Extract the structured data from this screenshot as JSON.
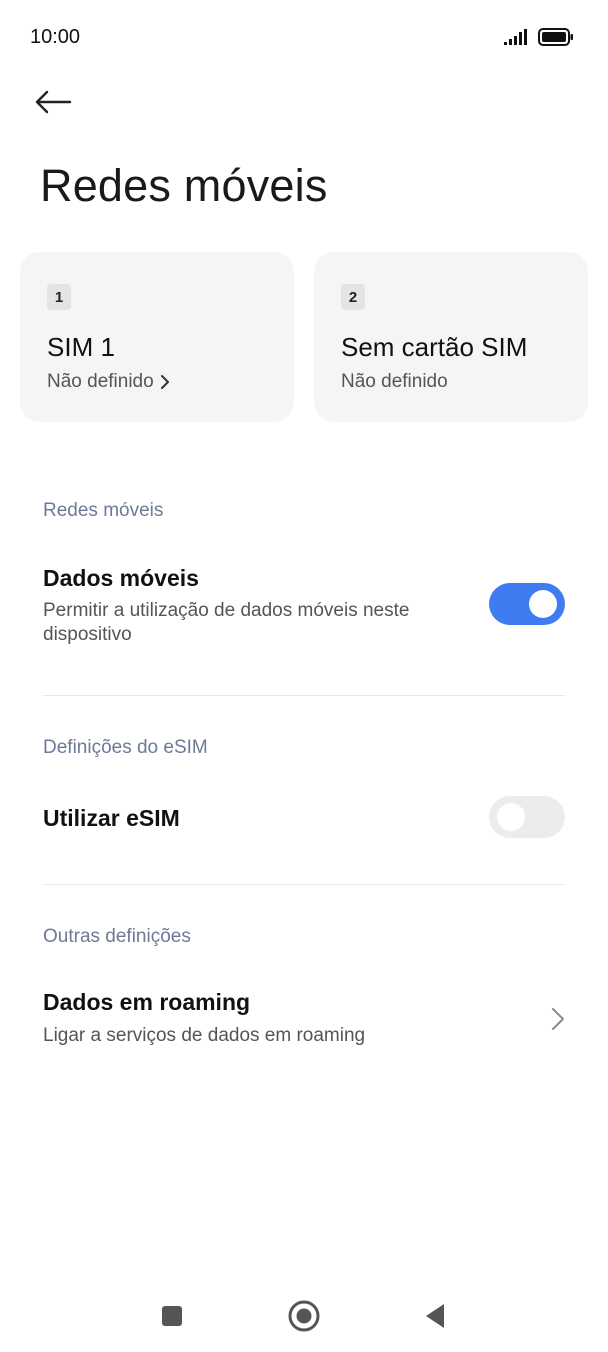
{
  "status_bar": {
    "time": "10:00",
    "icons": [
      "signal-icon",
      "battery-icon"
    ]
  },
  "header": {
    "back_icon": "arrow-left-icon",
    "title": "Redes móveis"
  },
  "sim_cards": [
    {
      "slot": "1",
      "name": "SIM 1",
      "status": "Não definido",
      "has_chevron": true
    },
    {
      "slot": "2",
      "name": "Sem cartão SIM",
      "status": "Não definido",
      "has_chevron": false
    }
  ],
  "sections": {
    "mobile_networks": {
      "header": "Redes móveis",
      "mobile_data": {
        "title": "Dados móveis",
        "subtitle": "Permitir a utilização de dados móveis neste dispositivo",
        "enabled": true
      }
    },
    "esim": {
      "header": "Definições do eSIM",
      "use_esim": {
        "title": "Utilizar eSIM",
        "enabled": false
      }
    },
    "other": {
      "header": "Outras definições",
      "roaming": {
        "title": "Dados em roaming",
        "subtitle": "Ligar a serviços de dados em roaming"
      }
    }
  },
  "colors": {
    "accent": "#3f7cf2",
    "section_header": "#6c7a97",
    "card_background": "#f5f5f5"
  },
  "nav_bar": {
    "icons": [
      "recents-square-icon",
      "home-circle-icon",
      "back-triangle-icon"
    ]
  }
}
